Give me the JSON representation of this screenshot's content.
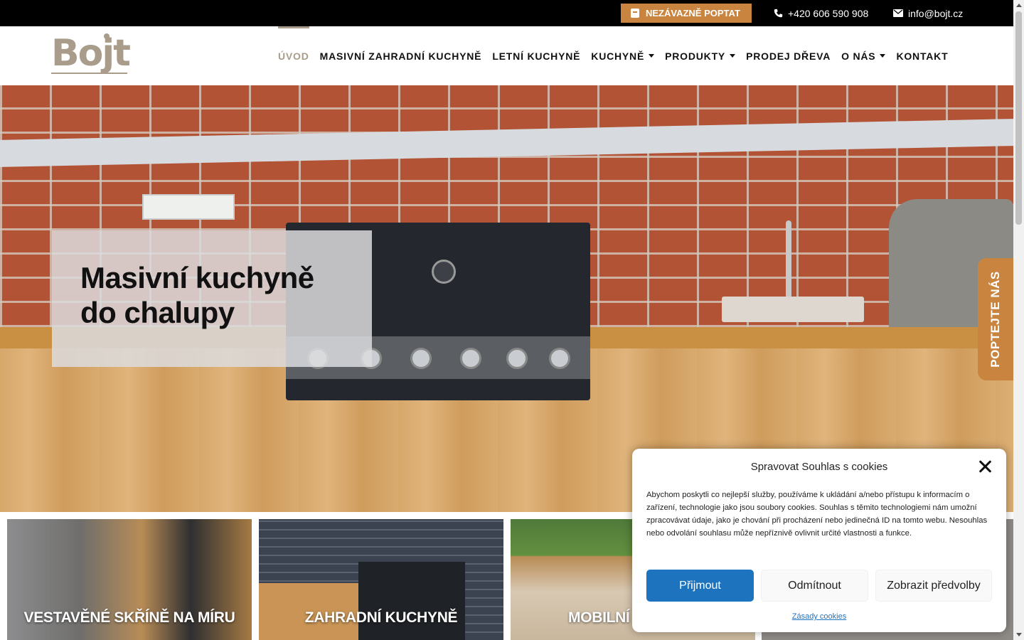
{
  "topbar": {
    "quote_label": "NEZÁVAZNĚ POPTAT",
    "phone": "+420 606 590 908",
    "email": "info@bojt.cz"
  },
  "header": {
    "logo_text": "Bojt",
    "nav": [
      {
        "label": "ÚVOD",
        "active": true
      },
      {
        "label": "MASIVNÍ ZAHRADNÍ KUCHYNĚ"
      },
      {
        "label": "LETNÍ KUCHYNĚ"
      },
      {
        "label": "KUCHYNĚ",
        "dropdown": true
      },
      {
        "label": "PRODUKTY",
        "dropdown": true
      },
      {
        "label": "PRODEJ DŘEVA"
      },
      {
        "label": "O NÁS",
        "dropdown": true
      },
      {
        "label": "KONTAKT"
      }
    ]
  },
  "hero": {
    "title_line1": "Masivní kuchyně",
    "title_line2": "do chalupy"
  },
  "side_tab": {
    "label": "POPTEJTE NÁS"
  },
  "tiles": [
    {
      "label": "VESTAVĚNÉ SKŘÍNĚ NA MÍRU"
    },
    {
      "label": "ZAHRADNÍ KUCHYNĚ"
    },
    {
      "label": "MOBILNÍ K"
    }
  ],
  "cookie": {
    "title": "Spravovat Souhlas s cookies",
    "text": "Abychom poskytli co nejlepší služby, používáme k ukládání a/nebo přístupu k informacím o zařízení, technologie jako jsou soubory cookies. Souhlas s těmito technologiemi nám umožní zpracovávat údaje, jako je chování při procházení nebo jedinečná ID na tomto webu. Nesouhlas nebo odvolání souhlasu může nepříznivě ovlivnit určité vlastnosti a funkce.",
    "accept": "Přijmout",
    "deny": "Odmítnout",
    "prefs": "Zobrazit předvolby",
    "link": "Zásady cookies"
  },
  "colors": {
    "accent": "#c9853f",
    "brand": "#a99c8a",
    "primary_button": "#1e73be"
  }
}
